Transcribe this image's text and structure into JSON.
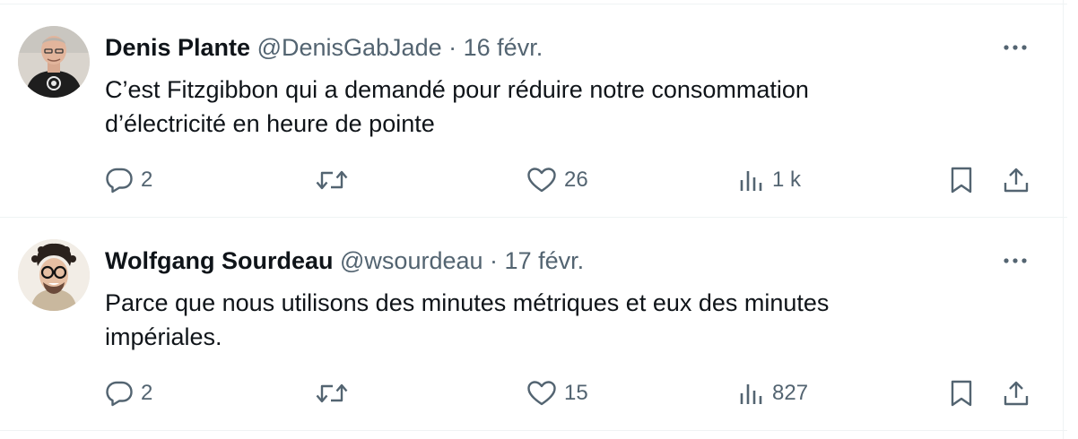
{
  "tweets": [
    {
      "author_name": "Denis Plante",
      "handle": "@DenisGabJade",
      "separator": "·",
      "date": "16 févr.",
      "text_line1": "C’est Fitzgibbon qui a demandé pour réduire notre consommation",
      "text_line2": "d’électricité en heure de pointe",
      "replies": "2",
      "likes": "26",
      "views": "1 k"
    },
    {
      "author_name": "Wolfgang Sourdeau",
      "handle": "@wsourdeau",
      "separator": "·",
      "date": "17 févr.",
      "text_line1": "Parce que nous utilisons des minutes métriques et eux des minutes",
      "text_line2": "impériales.",
      "replies": "2",
      "likes": "15",
      "views": "827"
    }
  ],
  "icons": {
    "more": "more-icon",
    "reply": "reply-icon",
    "retweet": "retweet-icon",
    "like": "heart-icon",
    "views": "views-icon",
    "bookmark": "bookmark-icon",
    "share": "share-icon"
  },
  "colors": {
    "text": "#0f1419",
    "secondary": "#536471",
    "divider": "#eff3f4"
  }
}
